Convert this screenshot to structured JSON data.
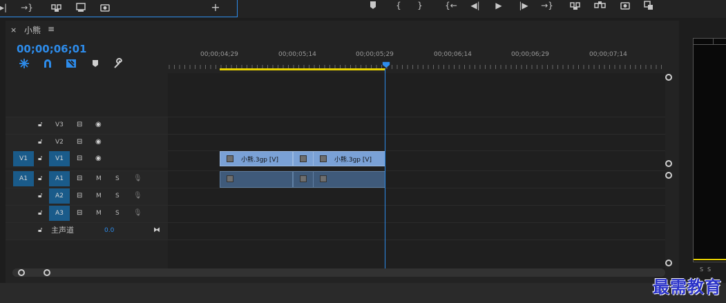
{
  "panel": {
    "close_label": "×",
    "title": "小熊",
    "menu_label": "≡",
    "timecode": "00;00;06;01"
  },
  "ruler": {
    "labels": [
      "00;00;04;29",
      "00;00;05;14",
      "00;00;05;29",
      "00;00;06;14",
      "00;00;06;29",
      "00;00;07;14"
    ]
  },
  "tracks": {
    "v3": {
      "name": "V3"
    },
    "v2": {
      "name": "V2"
    },
    "v1": {
      "source": "V1",
      "name": "V1"
    },
    "a1": {
      "source": "A1",
      "name": "A1",
      "m": "M",
      "s": "S"
    },
    "a2": {
      "name": "A2",
      "m": "M",
      "s": "S"
    },
    "a3": {
      "name": "A3",
      "m": "M",
      "s": "S"
    },
    "master": {
      "label": "主声道",
      "value": "0.0"
    }
  },
  "clips": {
    "v1_clip_1": "小熊.3gp [V]",
    "v1_clip_3": "小熊.3gp [V]"
  },
  "monitor": {
    "footer_s": "S",
    "footer_s2": "S"
  },
  "watermark": "最需教育",
  "colors": {
    "accent": "#2d8ceb",
    "work_area": "#e8d200",
    "video_clip": "#7aa1d6",
    "audio_clip": "#3f5a7a",
    "track_target": "#1a5b8a"
  }
}
